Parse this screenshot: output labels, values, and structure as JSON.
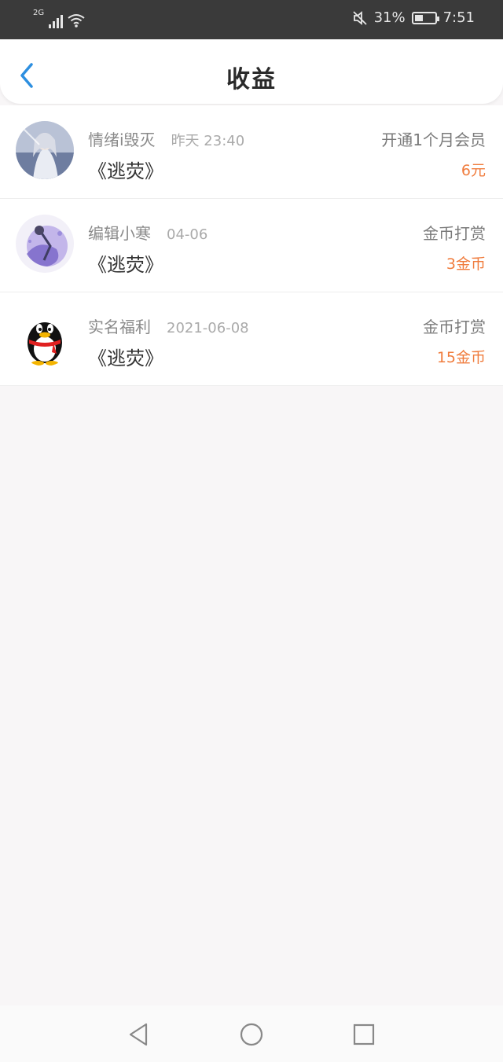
{
  "status_bar": {
    "network": "2G",
    "battery_percent": "31%",
    "time": "7:51",
    "icons": [
      "signal-icon",
      "wifi-icon",
      "mute-icon",
      "battery-icon"
    ]
  },
  "header": {
    "title": "收益",
    "back_icon": "chevron-left-icon"
  },
  "colors": {
    "accent": "#2d8fe0",
    "amount": "#f07c3d",
    "status_bar_bg": "#3a3a3a",
    "page_bg": "#f8f6f7"
  },
  "list": [
    {
      "user_name": "情绪i毁灭",
      "time": "昨天 23:40",
      "book_title": "《逃荧》",
      "type": "开通1个月会员",
      "amount": "6元",
      "avatar": "anime-portrait-avatar"
    },
    {
      "user_name": "编辑小寒",
      "time": "04-06",
      "book_title": "《逃荧》",
      "type": "金币打赏",
      "amount": "3金币",
      "avatar": "purple-illustration-avatar"
    },
    {
      "user_name": "实名福利",
      "time": "2021-06-08",
      "book_title": "《逃荧》",
      "type": "金币打赏",
      "amount": "15金币",
      "avatar": "qq-penguin-avatar"
    }
  ],
  "nav_bar": {
    "icons": [
      "back-triangle-icon",
      "home-circle-icon",
      "recents-square-icon"
    ]
  }
}
